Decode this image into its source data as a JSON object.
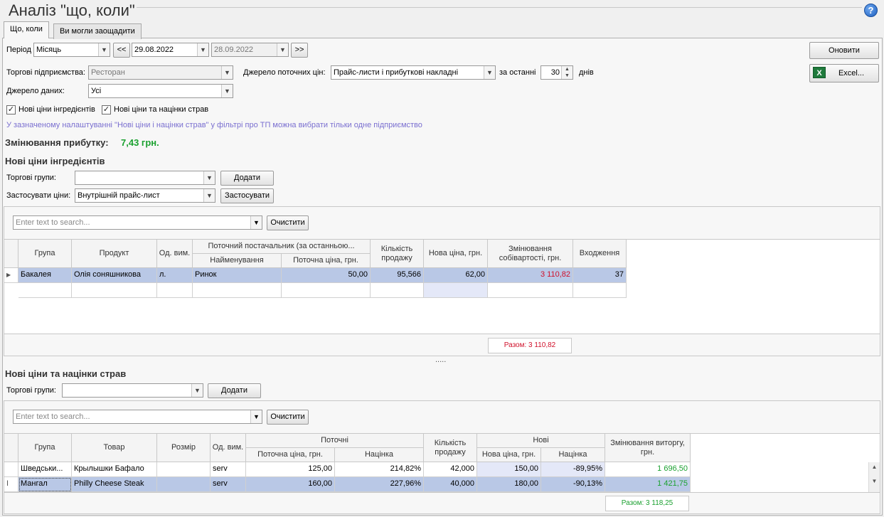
{
  "title": "Аналіз \"що, коли\"",
  "tabs": [
    "Що, коли",
    "Ви могли заощадити"
  ],
  "filters": {
    "period_label": "Період",
    "period_value": "Місяць",
    "prev": "<<",
    "date_from": "29.08.2022",
    "date_to": "28.09.2022",
    "next": ">>",
    "enterprises_label": "Торгові підприємства:",
    "enterprises_value": "Ресторан",
    "price_source_label": "Джерело поточних цін:",
    "price_source_value": "Прайс-листи і прибуткові накладні",
    "last_label": "за останні",
    "last_value": "30",
    "days_label": "днів",
    "data_source_label": "Джерело даних:",
    "data_source_value": "Усі",
    "chk_ingredients": "Нові ціни інгредієнтів",
    "chk_dishes": "Нові ціни та націнки страв",
    "info": "У зазначеному налаштуванні \"Нові ціни і націнки страв\" у фільтрі про ТП можна вибрати тільки одне підприємство"
  },
  "buttons": {
    "refresh": "Оновити",
    "excel": "Excel..."
  },
  "profit": {
    "label": "Змінювання прибутку:",
    "value": "7,43 грн."
  },
  "ingredients": {
    "title": "Нові ціни інгредієнтів",
    "groups_label": "Торгові групи:",
    "groups_value": "",
    "add": "Додати",
    "apply_label": "Застосувати ціни:",
    "apply_value": "Внутрішній прайс-лист",
    "apply_btn": "Застосувати",
    "search_placeholder": "Enter text to search...",
    "clear": "Очистити",
    "headers": {
      "group": "Група",
      "product": "Продукт",
      "unit": "Од. вим.",
      "supplier": "Поточний постачальник (за останньою...",
      "name": "Найменування",
      "cur_price": "Поточна ціна, грн.",
      "qty": "Кількість продажу",
      "new_price": "Нова ціна, грн.",
      "cost_change": "Змінювання собівартості, грн.",
      "occurrence": "Входження"
    },
    "rows": [
      {
        "group": "Бакалея",
        "product": "Олія соняшникова",
        "unit": "л.",
        "name": "Ринок",
        "cur_price": "50,00",
        "qty": "95,566",
        "new_price": "62,00",
        "cost_change": "3 110,82",
        "occurrence": "37"
      }
    ],
    "total": "Разом: 3 110,82"
  },
  "splitter": ".....",
  "dishes": {
    "title": "Нові ціни та націнки страв",
    "groups_label": "Торгові групи:",
    "groups_value": "",
    "add": "Додати",
    "search_placeholder": "Enter text to search...",
    "clear": "Очистити",
    "headers": {
      "group": "Група",
      "item": "Товар",
      "size": "Розмір",
      "unit": "Од. вим.",
      "current": "Поточні",
      "cur_price": "Поточна ціна, грн.",
      "markup": "Націнка",
      "qty": "Кількість продажу",
      "new": "Нові",
      "new_price": "Нова ціна, грн.",
      "new_markup": "Націнка",
      "rev_change": "Змінювання виторгу, грн."
    },
    "rows": [
      {
        "group": "Шведськи...",
        "item": "Крылышки Бафало",
        "size": "",
        "unit": "serv",
        "cur_price": "125,00",
        "markup": "214,82%",
        "qty": "42,000",
        "new_price": "150,00",
        "new_markup": "-89,95%",
        "rev_change": "1 696,50"
      },
      {
        "group": "Мангал",
        "item": "Philly Cheese Steak",
        "size": "",
        "unit": "serv",
        "cur_price": "160,00",
        "markup": "227,96%",
        "qty": "40,000",
        "new_price": "180,00",
        "new_markup": "-90,13%",
        "rev_change": "1 421,75"
      }
    ],
    "total": "Разом: 3 118,25"
  },
  "colors": {
    "positive": "#1ba130",
    "negative": "#d0102a",
    "selection": "#b9c8e6"
  }
}
